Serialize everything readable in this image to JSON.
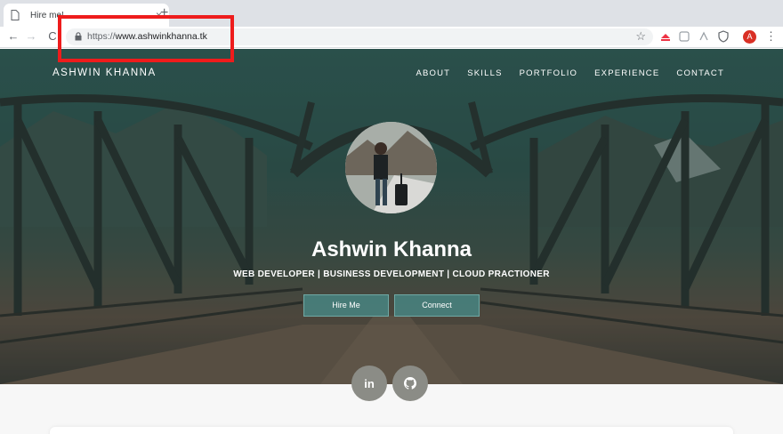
{
  "browser": {
    "tab_title": "Hire me!",
    "tab_close": "×",
    "new_tab": "+",
    "back": "←",
    "forward": "→",
    "reload": "C",
    "url_scheme": "https://",
    "url_host": "www.ashwinkhanna.tk",
    "star": "☆",
    "profile_initial": "A",
    "menu": "⋮"
  },
  "site": {
    "brand": "ASHWIN KHANNA",
    "nav": [
      "ABOUT",
      "SKILLS",
      "PORTFOLIO",
      "EXPERIENCE",
      "CONTACT"
    ],
    "name": "Ashwin Khanna",
    "subtitle": "WEB DEVELOPER | BUSINESS DEVELOPMENT | CLOUD PRACTIONER",
    "cta_hire": "Hire Me",
    "cta_connect": "Connect",
    "social_linkedin": "in",
    "social_github": "github-icon"
  },
  "colors": {
    "highlight": "#ee1c1c",
    "cta_bg": "#488a88",
    "social_bg": "#8b8c86",
    "profile": "#d93025"
  }
}
